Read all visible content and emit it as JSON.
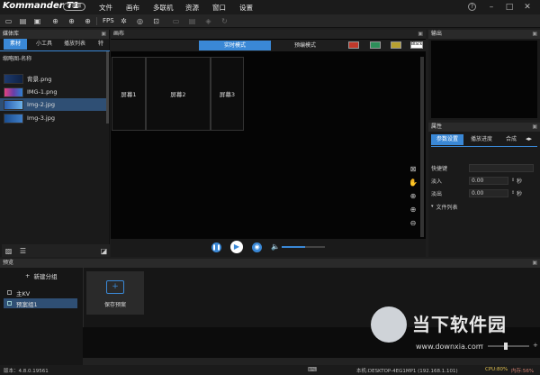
{
  "app": {
    "logo_text": "Kommander T1",
    "logo_badge": "公测版",
    "menu": [
      "文件",
      "画布",
      "多联机",
      "资源",
      "窗口",
      "设置"
    ],
    "window_controls": [
      "help-icon",
      "minimize-icon",
      "maximize-icon",
      "close-icon"
    ]
  },
  "toolbar": {
    "fps_label": "FPS",
    "icons": [
      "new-icon",
      "open-icon",
      "save-icon",
      "add-icon",
      "zoom-in-icon",
      "add-screen-icon",
      "settings-icon",
      "record-icon",
      "window-icon",
      "folder-icon",
      "layout-icon",
      "layers-icon",
      "refresh-icon"
    ]
  },
  "media": {
    "title": "媒体库",
    "tabs": [
      "素材",
      "小工具",
      "播放列表"
    ],
    "tab_more": "特",
    "column_header": "缩略图-名称",
    "items": [
      {
        "name": "背景.png",
        "color": "#1d3a6e"
      },
      {
        "name": "IMG-1.png",
        "color": "#6a3da8"
      },
      {
        "name": "Img-2.jpg",
        "color": "#2a5fb0"
      },
      {
        "name": "Img-3.jpg",
        "color": "#1a4d90"
      }
    ],
    "selected_index": 2
  },
  "canvas": {
    "title": "画布",
    "modes": [
      "实时模式",
      "预编模式"
    ],
    "active_mode": 0,
    "swatches": [
      "#c0392b",
      "#2d8f5a",
      "#b8a030",
      "#ffffff"
    ],
    "swatch_label": "Black",
    "screens": [
      "屏幕1",
      "屏幕2",
      "屏幕3"
    ],
    "player": {
      "progress": 0.55
    }
  },
  "output": {
    "title": "输出"
  },
  "props": {
    "title": "属性",
    "tabs": [
      "参数设置",
      "播放进度",
      "合成"
    ],
    "rows": [
      {
        "label": "快捷键",
        "value": "",
        "unit": ""
      },
      {
        "label": "淡入",
        "value": "0.00",
        "unit": "秒"
      },
      {
        "label": "淡出",
        "value": "0.00",
        "unit": "秒"
      }
    ],
    "section": "文件列表"
  },
  "preview": {
    "title": "预览",
    "new_group": "新建分组",
    "groups": [
      "主KV",
      "预案组1"
    ],
    "selected_group": 1,
    "save_label": "保存预案"
  },
  "status": {
    "version": "版本：4.8.0.19561",
    "host": "本机:DESKTOP-4EG1MP1 (192.168.1.101)",
    "cpu": "CPU:80%",
    "mem": "内存:56%"
  },
  "watermark": {
    "title": "当下软件园",
    "url": "www.downxia.com"
  },
  "colors": {
    "accent": "#3a88d6"
  }
}
